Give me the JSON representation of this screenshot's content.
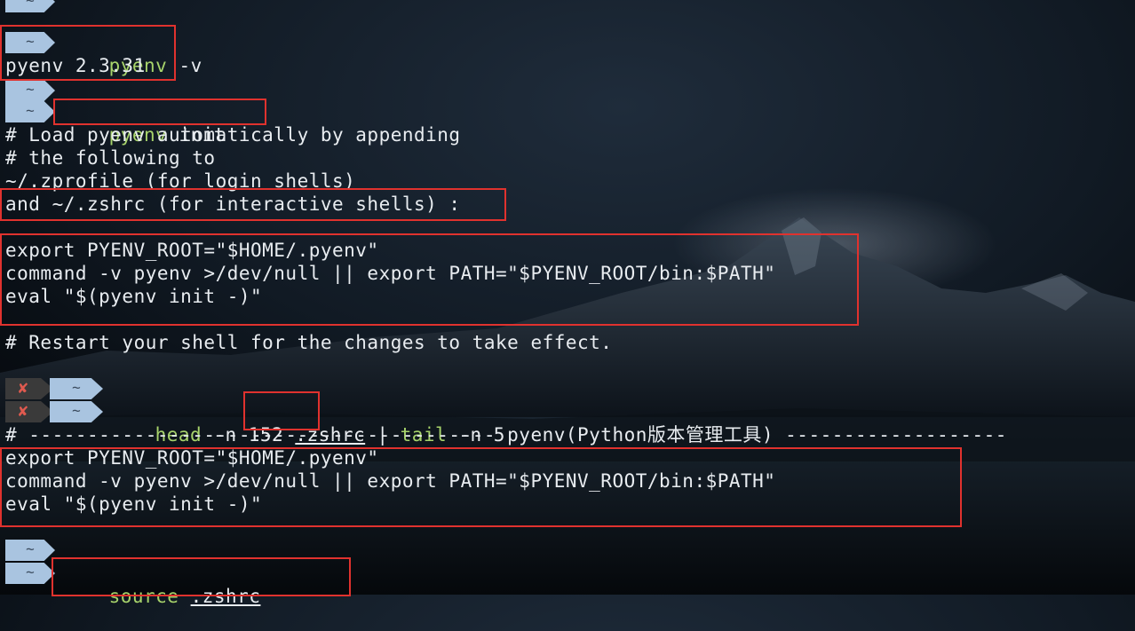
{
  "prompt": {
    "home_symbol": "~",
    "error_symbol": "✘"
  },
  "lines": {
    "l1_cmd": "pyenv",
    "l1_args": " -v",
    "l2": "pyenv 2.3.31",
    "l3_cmd": "pyenv",
    "l3_args": " init",
    "l4": "# Load pyenv automatically by appending",
    "l5": "# the following to",
    "l6": "~/.zprofile (for login shells)",
    "l7": "and ~/.zshrc (for interactive shells) :",
    "l8": "export PYENV_ROOT=\"$HOME/.pyenv\"",
    "l9": "command -v pyenv >/dev/null || export PATH=\"$PYENV_ROOT/bin:$PATH\"",
    "l10": "eval \"$(pyenv init -)\"",
    "l11": "# Restart your shell for the changes to take effect.",
    "l12_cmd": "head",
    "l12_args1": " -n 152 ",
    "l12_file": ".zshrc",
    "l12_pipe": " | ",
    "l12_cmd2": "tail",
    "l12_args2": " -n 5",
    "l13": "# ---------------------------------------- pyenv(Python版本管理工具) -------------------",
    "l14": "export PYENV_ROOT=\"$HOME/.pyenv\"",
    "l15": "command -v pyenv >/dev/null || export PATH=\"$PYENV_ROOT/bin:$PATH\"",
    "l16": "eval \"$(pyenv init -)\"",
    "l17_cmd": "source",
    "l17_space": " ",
    "l17_file": ".zshrc"
  },
  "colors": {
    "command": "#a7d36b",
    "highlight_box": "#e0322e",
    "prompt_chevron": "#a9c4e0",
    "error_mark": "#e05a4f"
  }
}
